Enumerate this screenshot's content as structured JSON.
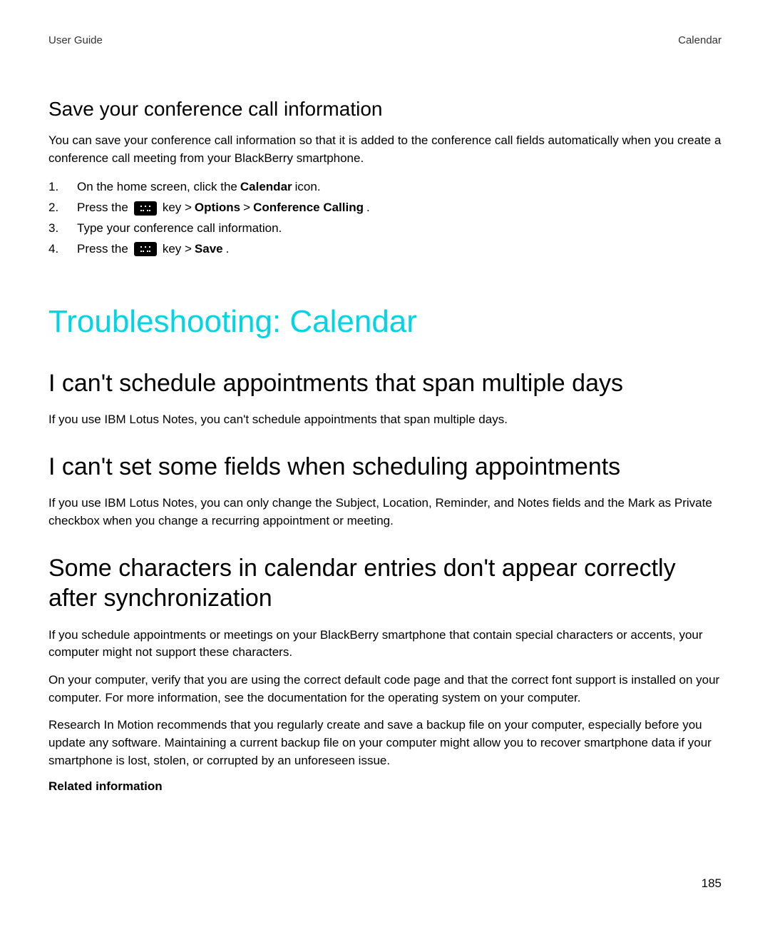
{
  "header": {
    "left": "User Guide",
    "right": "Calendar"
  },
  "section1": {
    "title": "Save your conference call information",
    "intro": "You can save your conference call information so that it is added to the conference call fields automatically when you create a conference call meeting from your BlackBerry smartphone.",
    "steps": {
      "n1": "1.",
      "s1a": "On the home screen, click the ",
      "s1b": "Calendar",
      "s1c": " icon.",
      "n2": "2.",
      "s2a": "Press the ",
      "s2b": " key > ",
      "s2c": "Options",
      "s2d": " > ",
      "s2e": "Conference Calling",
      "s2f": ".",
      "n3": "3.",
      "s3a": "Type your conference call information.",
      "n4": "4.",
      "s4a": "Press the ",
      "s4b": " key > ",
      "s4c": "Save",
      "s4d": "."
    }
  },
  "mainHeading": "Troubleshooting: Calendar",
  "issue1": {
    "title": "I can't schedule appointments that span multiple days",
    "body": "If you use IBM Lotus Notes, you can't schedule appointments that span multiple days."
  },
  "issue2": {
    "title": "I can't set some fields when scheduling appointments",
    "body": "If you use IBM Lotus Notes, you can only change the Subject, Location, Reminder, and Notes fields and the Mark as Private checkbox when you change a recurring appointment or meeting."
  },
  "issue3": {
    "title": "Some characters in calendar entries don't appear correctly after synchronization",
    "p1": "If you schedule appointments or meetings on your BlackBerry smartphone that contain special characters or accents, your computer might not support these characters.",
    "p2": "On your computer, verify that you are using the correct default code page and that the correct font support is installed on your computer. For more information, see the documentation for the operating system on your computer.",
    "p3": "Research In Motion recommends that you regularly create and save a backup file on your computer, especially before you update any software. Maintaining a current backup file on your computer might allow you to recover smartphone data if your smartphone is lost, stolen, or corrupted by an unforeseen issue."
  },
  "related": "Related information",
  "pageNumber": "185"
}
